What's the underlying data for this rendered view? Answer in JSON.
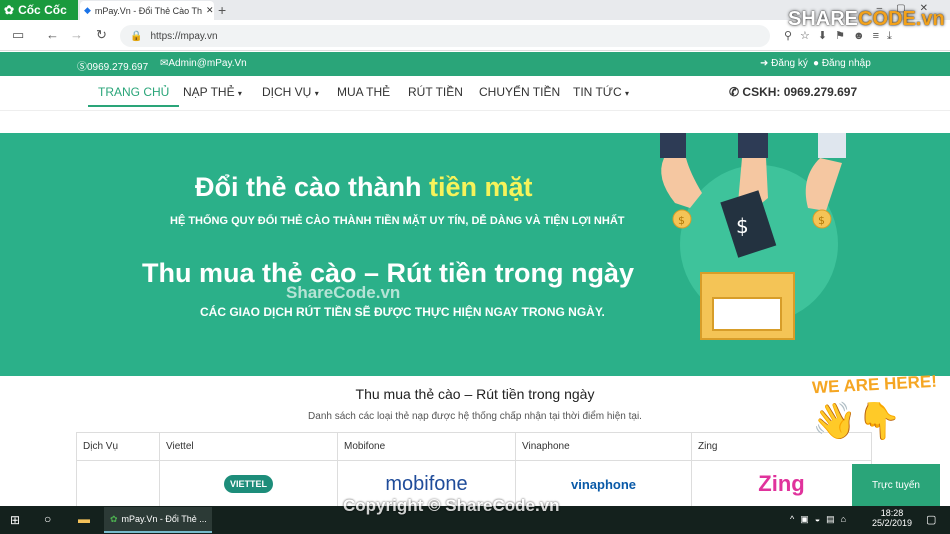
{
  "browser": {
    "brand": "Cốc Cốc",
    "tab_title": "mPay.Vn - Đổi Thẻ Cào Th",
    "url": "https://mpay.vn",
    "sc_logo_a": "SHARE",
    "sc_logo_b": "CODE.vn"
  },
  "topbar": {
    "phone": "0969.279.697",
    "email": "Admin@mPay.Vn",
    "register": "Đăng ký",
    "login": "Đăng nhập"
  },
  "nav": {
    "items": [
      "TRANG CHỦ",
      "NẠP THẺ",
      "DỊCH VỤ",
      "MUA THẺ",
      "RÚT TIỀN",
      "CHUYỂN TIỀN",
      "TIN TỨC"
    ],
    "hotline": "CSKH: 0969.279.697"
  },
  "hero": {
    "title_a": "Đổi thẻ cào thành ",
    "title_b": "tiền mặt",
    "sub1": "HỆ THỐNG QUY ĐỔI THẺ CÀO THÀNH TIỀN MẶT UY TÍN, DỄ DÀNG VÀ TIỆN LỢI NHẤT",
    "title2": "Thu mua thẻ cào – Rút tiền trong ngày",
    "sub2": "CÁC GIAO DỊCH RÚT TIỀN SẼ ĐƯỢC THỰC HIỆN NGAY TRONG NGÀY.",
    "watermark": "ShareCode.vn"
  },
  "section": {
    "title": "Thu mua thẻ cào – Rút tiền trong ngày",
    "subtitle": "Danh sách các loại thẻ nạp được hệ thống chấp nhận tại thời điểm hiện tại.",
    "headers": [
      "Dịch Vụ",
      "Viettel",
      "Mobifone",
      "Vinaphone",
      "Zing"
    ],
    "logos": [
      "VIETTEL",
      "mobifone",
      "vinaphone",
      "Zing"
    ]
  },
  "widget": {
    "we_are_here": "WE ARE HERE!",
    "support": "Trực tuyến"
  },
  "taskbar": {
    "app": "mPay.Vn - Đổi Thẻ ...",
    "time": "18:28",
    "date": "25/2/2019",
    "copyright": "Copyright © ShareCode.vn"
  }
}
